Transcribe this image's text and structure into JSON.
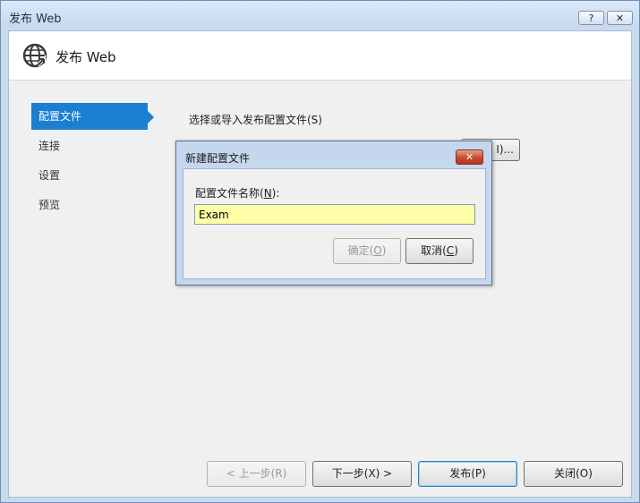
{
  "window": {
    "title": "发布 Web",
    "help_label": "?",
    "close_label": "✕"
  },
  "header": {
    "title": "发布 Web",
    "icon": "globe-publish-icon"
  },
  "nav": {
    "items": [
      {
        "label": "配置文件",
        "active": true
      },
      {
        "label": "连接",
        "active": false
      },
      {
        "label": "设置",
        "active": false
      },
      {
        "label": "预览",
        "active": false
      }
    ]
  },
  "profile": {
    "section_label": "选择或导入发布配置文件(S)",
    "import_label": "I)..."
  },
  "dialog": {
    "title": "新建配置文件",
    "field_label_pre": "配置文件名称(",
    "field_label_key": "N",
    "field_label_post": "):",
    "field_value": "Exam",
    "ok_pre": "确定(",
    "ok_key": "O",
    "ok_post": ")",
    "cancel_pre": "取消(",
    "cancel_key": "C",
    "cancel_post": ")",
    "close_label": "✕"
  },
  "footer": {
    "prev_label": "< 上一步(R)",
    "next_label": "下一步(X) >",
    "publish_label": "发布(P)",
    "close_label": "关闭(O)"
  },
  "colors": {
    "accent": "#1a7fd1",
    "input_highlight": "#ffffa8"
  }
}
